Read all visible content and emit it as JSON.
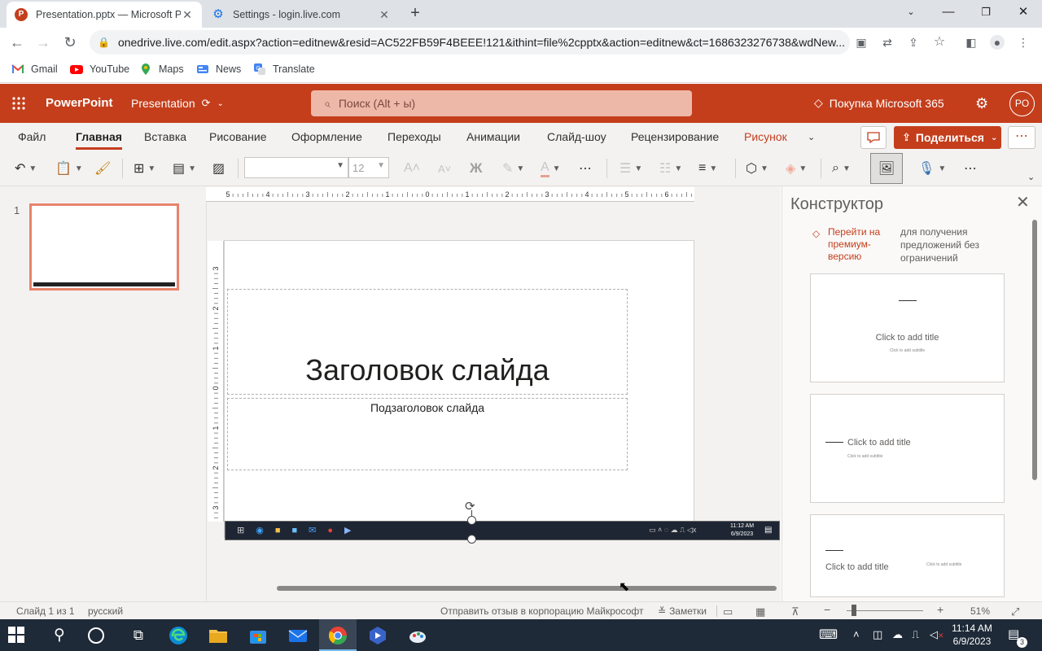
{
  "browser": {
    "tabs": [
      {
        "title": "Presentation.pptx — Microsoft P",
        "icon": "powerpoint-icon",
        "active": true
      },
      {
        "title": "Settings - login.live.com",
        "icon": "gear-icon",
        "active": false
      }
    ],
    "url": "onedrive.live.com/edit.aspx?action=editnew&resid=AC522FB59F4BEEE!121&ithint=file%2cpptx&action=editnew&ct=1686323276738&wdNew...",
    "bookmarks": [
      "Gmail",
      "YouTube",
      "Maps",
      "News",
      "Translate"
    ]
  },
  "app": {
    "name": "PowerPoint",
    "document": "Presentation",
    "search_placeholder": "Поиск (Alt + ы)",
    "buy": "Покупка Microsoft 365",
    "avatar": "PO"
  },
  "ribbon": {
    "tabs": [
      "Файл",
      "Главная",
      "Вставка",
      "Рисование",
      "Оформление",
      "Переходы",
      "Анимации",
      "Слайд-шоу",
      "Рецензирование",
      "Рисунок"
    ],
    "selected_tab": "Главная",
    "contextual_tab": "Рисунок",
    "share": "Поделиться",
    "font_size": "12",
    "bold_glyph": "Ж"
  },
  "thumbnails": {
    "slide_number": "1"
  },
  "rulers": {
    "horizontal": [
      "5",
      "4",
      "3",
      "2",
      "1",
      "0",
      "1",
      "2",
      "3",
      "4",
      "5",
      "6"
    ],
    "vertical": [
      "3",
      "2",
      "1",
      "0",
      "1",
      "2",
      "3"
    ]
  },
  "slide": {
    "title": "Заголовок слайда",
    "subtitle": "Подзаголовок слайда",
    "image_clock_time": "11:12 AM",
    "image_clock_date": "6/9/2023"
  },
  "designer": {
    "title": "Конструктор",
    "premium_link": "Перейти на премиум-версию",
    "premium_note": "для получения предложений без ограничений",
    "cards": [
      {
        "title": "Click to add title",
        "subtitle": "Click to add subtitle"
      },
      {
        "title": "Click to add title",
        "subtitle": "Click to add subtitle"
      },
      {
        "title": "Click to add title",
        "subtitle": "Click to add subtitle"
      }
    ]
  },
  "status": {
    "slide_count": "Слайд 1 из 1",
    "language": "русский",
    "feedback": "Отправить отзыв в корпорацию Майкрософт",
    "notes": "Заметки",
    "zoom": "51%"
  },
  "taskbar": {
    "time": "11:14 AM",
    "date": "6/9/2023",
    "notification_count": "3"
  },
  "colors": {
    "accent": "#c43e1c",
    "taskbar": "#1f2a38"
  }
}
